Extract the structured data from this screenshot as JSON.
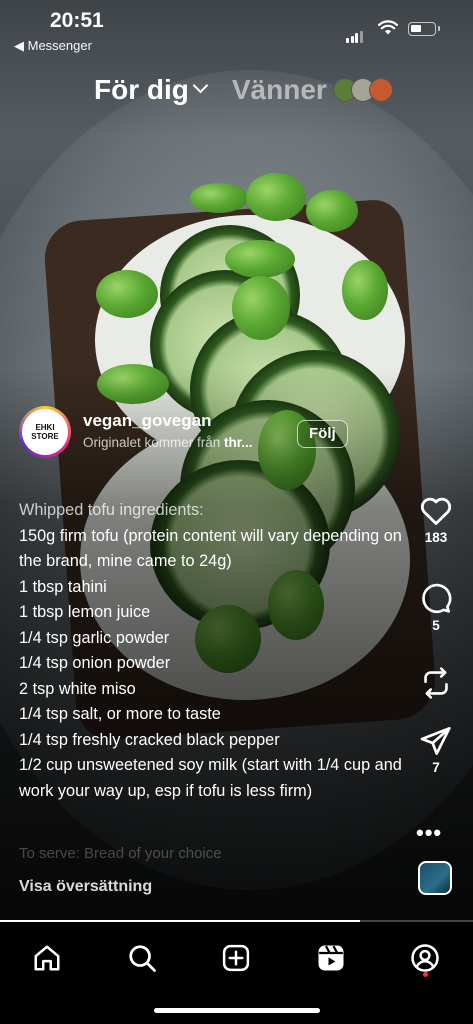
{
  "status_bar": {
    "time": "20:51",
    "back_app": "◀ Messenger"
  },
  "header": {
    "tab_for_you": "För dig",
    "tab_friends": "Vänner"
  },
  "post": {
    "username": "vegan_govegan",
    "subtitle_prefix": "Originalet kommer från ",
    "subtitle_bold": "thr...",
    "follow_label": "Följ",
    "avatar_text": "EHKI STORE",
    "caption_title": "Whipped tofu ingredients:",
    "caption_lines": [
      "150g firm tofu (protein content will vary depending on the brand, mine came to 24g)",
      "1 tbsp tahini",
      "1 tbsp lemon juice",
      "1/4 tsp garlic powder",
      "1/4 tsp onion powder",
      "2 tsp white miso",
      "1/4 tsp salt, or more to taste",
      "1/4 tsp freshly cracked black pepper",
      "1/2 cup unsweetened soy milk (start with 1/4 cup and work your way up, esp if tofu is less firm)"
    ],
    "caption_faded": "To serve: Bread of your choice",
    "translate_label": "Visa översättning"
  },
  "actions": {
    "like_count": "183",
    "comment_count": "5",
    "share_count": "7"
  },
  "nav": {
    "items": [
      "home",
      "search",
      "create",
      "reels",
      "profile"
    ]
  }
}
